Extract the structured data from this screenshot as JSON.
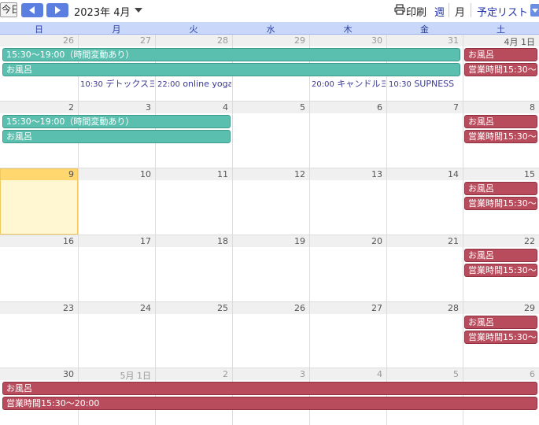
{
  "toolbar": {
    "today_label": "今日",
    "month_title": "2023年 4月",
    "print_label": "印刷",
    "view_week": "週",
    "view_month": "月",
    "view_list": "予定リスト"
  },
  "weekdays": [
    "日",
    "月",
    "火",
    "水",
    "木",
    "金",
    "土"
  ],
  "weeks": [
    {
      "dates": [
        {
          "label": "26",
          "other": true
        },
        {
          "label": "27",
          "other": true
        },
        {
          "label": "28",
          "other": true
        },
        {
          "label": "29",
          "other": true
        },
        {
          "label": "30",
          "other": true
        },
        {
          "label": "31",
          "other": true
        },
        {
          "label": "4月 1日",
          "other": false
        }
      ]
    },
    {
      "dates": [
        {
          "label": "2",
          "other": false
        },
        {
          "label": "3",
          "other": false
        },
        {
          "label": "4",
          "other": false
        },
        {
          "label": "5",
          "other": false
        },
        {
          "label": "6",
          "other": false
        },
        {
          "label": "7",
          "other": false
        },
        {
          "label": "8",
          "other": false
        }
      ]
    },
    {
      "dates": [
        {
          "label": "9",
          "other": false
        },
        {
          "label": "10",
          "other": false
        },
        {
          "label": "11",
          "other": false
        },
        {
          "label": "12",
          "other": false
        },
        {
          "label": "13",
          "other": false
        },
        {
          "label": "14",
          "other": false
        },
        {
          "label": "15",
          "other": false
        }
      ]
    },
    {
      "dates": [
        {
          "label": "16",
          "other": false
        },
        {
          "label": "17",
          "other": false
        },
        {
          "label": "18",
          "other": false
        },
        {
          "label": "19",
          "other": false
        },
        {
          "label": "20",
          "other": false
        },
        {
          "label": "21",
          "other": false
        },
        {
          "label": "22",
          "other": false
        }
      ]
    },
    {
      "dates": [
        {
          "label": "23",
          "other": false
        },
        {
          "label": "24",
          "other": false
        },
        {
          "label": "25",
          "other": false
        },
        {
          "label": "26",
          "other": false
        },
        {
          "label": "27",
          "other": false
        },
        {
          "label": "28",
          "other": false
        },
        {
          "label": "29",
          "other": false
        }
      ]
    },
    {
      "dates": [
        {
          "label": "30",
          "other": false
        },
        {
          "label": "5月 1日",
          "other": true
        },
        {
          "label": "2",
          "other": true
        },
        {
          "label": "3",
          "other": true
        },
        {
          "label": "4",
          "other": true
        },
        {
          "label": "5",
          "other": true
        },
        {
          "label": "6",
          "other": true
        }
      ]
    }
  ],
  "events": {
    "w1_hours": "15:30～19:00（時間変動あり）",
    "w1_bath": "お風呂",
    "w1_sat_bath": "お風呂",
    "w1_sat_hours": "営業時間15:30～",
    "w1_mon_time": "10:30",
    "w1_mon_title": "デトックスヨ",
    "w1_tue_time": "22:00",
    "w1_tue_title": "online yoga",
    "w1_thu_time": "20:00",
    "w1_thu_title": "キャンドルヨ",
    "w1_fri_time": "10:30",
    "w1_fri_title": "SUPNESS",
    "w2_hours": "15:30～19:00（時間変動あり）",
    "w2_bath": "お風呂",
    "w2_sat_bath": "お風呂",
    "w2_sat_hours": "営業時間15:30～",
    "w3_sat_bath": "お風呂",
    "w3_sat_hours": "営業時間15:30～",
    "w4_sat_bath": "お風呂",
    "w4_sat_hours": "営業時間15:30～",
    "w5_sat_bath": "お風呂",
    "w5_sat_hours": "営業時間15:30～",
    "w6_bath": "お風呂",
    "w6_hours": "営業時間15:30～20:00"
  },
  "colors": {
    "teal_event": "#5abfae",
    "red_event": "#b84c5c",
    "header_bg": "#c9d7fb",
    "today_bg": "#fff6d2",
    "today_strip": "#ffd76e"
  }
}
